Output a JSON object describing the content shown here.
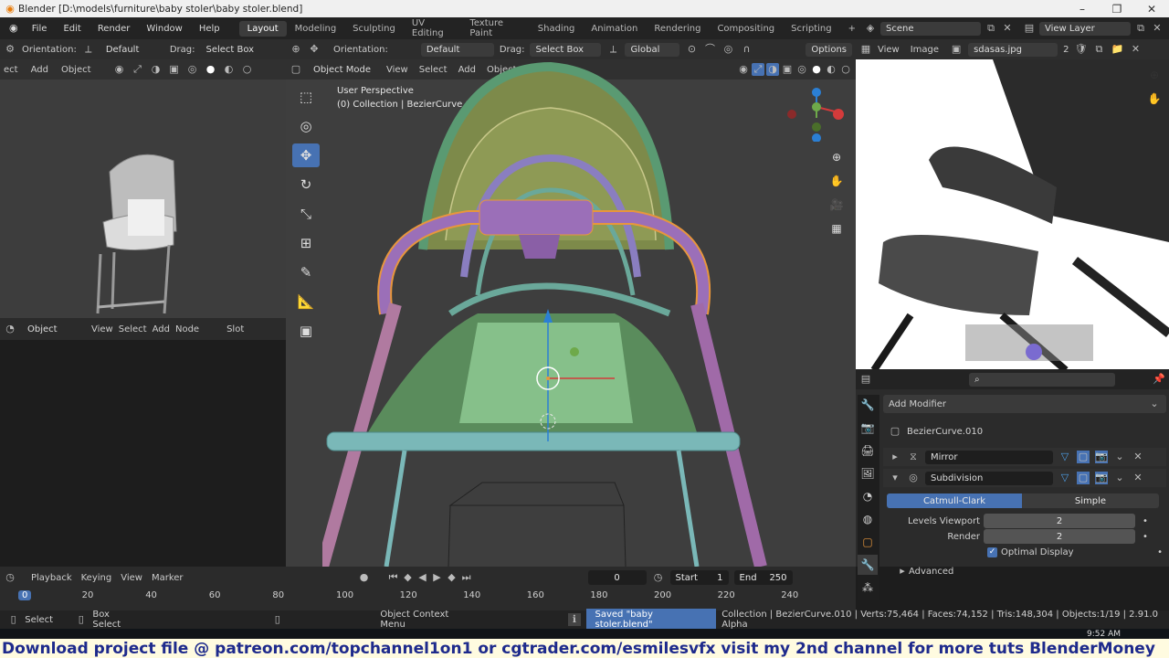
{
  "window": {
    "title": "Blender [D:\\models\\furniture\\baby stoler\\baby stoler.blend]",
    "min": "–",
    "max": "❐",
    "close": "✕"
  },
  "menu": [
    "File",
    "Edit",
    "Render",
    "Window",
    "Help"
  ],
  "workspaces": [
    "Layout",
    "Modeling",
    "Sculpting",
    "UV Editing",
    "Texture Paint",
    "Shading",
    "Animation",
    "Rendering",
    "Compositing",
    "Scripting"
  ],
  "scene": {
    "name": "Scene",
    "view_layer": "View Layer"
  },
  "left_header": {
    "orientation_label": "Orientation:",
    "orientation": "Default",
    "drag_label": "Drag:",
    "drag": "Select Box"
  },
  "left_menu": {
    "select": "ect",
    "add": "Add",
    "object": "Object"
  },
  "node_header": {
    "mode": "Object",
    "view": "View",
    "select": "Select",
    "add": "Add",
    "node": "Node",
    "slot": "Slot"
  },
  "viewport": {
    "orientation_label": "Orientation:",
    "orientation": "Default",
    "drag_label": "Drag:",
    "drag": "Select Box",
    "transform": "Global",
    "options": "Options",
    "mode": "Object Mode",
    "view": "View",
    "select": "Select",
    "add": "Add",
    "object": "Object",
    "info1": "User Perspective",
    "info2": "(0) Collection | BezierCurve.010"
  },
  "image_editor": {
    "view": "View",
    "image": "Image",
    "filename": "sdasas.jpg",
    "users": "2"
  },
  "properties": {
    "add_modifier": "Add Modifier",
    "object_name": "BezierCurve.010",
    "modifiers": [
      {
        "name": "Mirror",
        "type_icon": "mirror-icon"
      },
      {
        "name": "Subdivision",
        "type_icon": "subdivision-icon"
      }
    ],
    "subdiv": {
      "mode_a": "Catmull-Clark",
      "mode_b": "Simple",
      "levels_label": "Levels Viewport",
      "levels": "2",
      "render_label": "Render",
      "render": "2",
      "optimal": "Optimal Display",
      "advanced": "Advanced"
    }
  },
  "timeline": {
    "playback": "Playback",
    "keying": "Keying",
    "view": "View",
    "marker": "Marker",
    "current": "0",
    "start_label": "Start",
    "start": "1",
    "end_label": "End",
    "end": "250",
    "ticks": [
      "0",
      "20",
      "40",
      "60",
      "80",
      "100",
      "120",
      "140",
      "160",
      "180",
      "200",
      "220",
      "240"
    ]
  },
  "status": {
    "select": "Select",
    "box_select": "Box Select",
    "context": "Object Context Menu",
    "saved": "Saved \"baby stoler.blend\"",
    "stats": "Collection | BezierCurve.010 | Verts:75,464 | Faces:74,152 | Tris:148,304 | Objects:1/19 | 2.91.0 Alpha"
  },
  "clock": "9:52 AM",
  "banner": "Download project file @ patreon.com/topchannel1on1 or cgtrader.com/esmilesvfx  visit my 2nd channel for more tuts BlenderMoney",
  "colors": {
    "accent": "#4772b3",
    "selected_outline": "#e8963c",
    "panel": "#2b2b2b",
    "banner_text": "#1e2a8c"
  }
}
